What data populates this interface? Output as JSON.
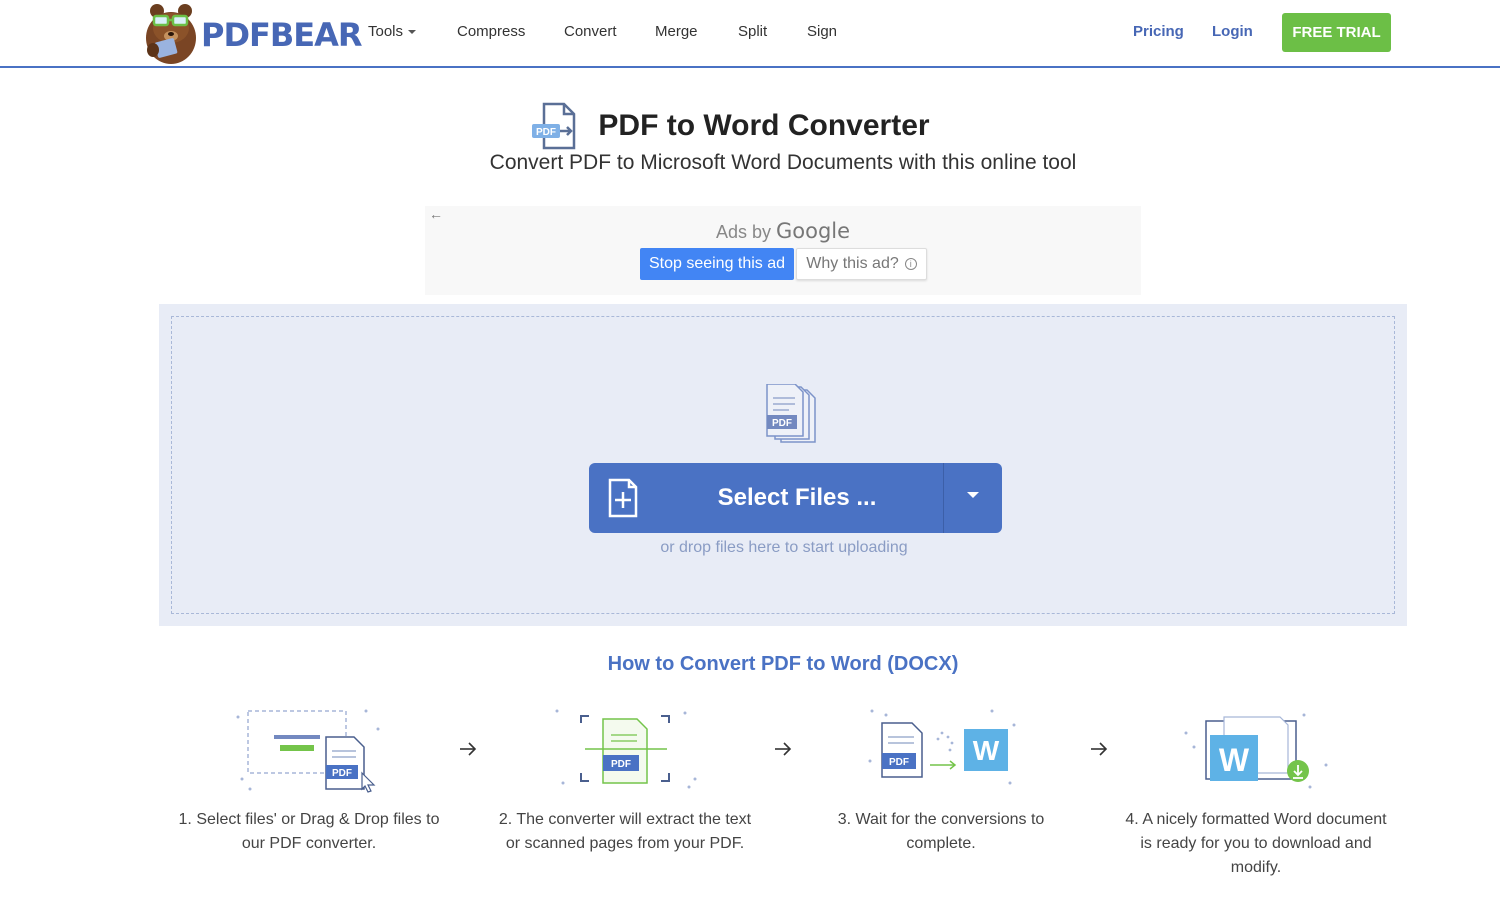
{
  "nav": {
    "brand": "PDFBEAR",
    "tools_label": "Tools",
    "links": [
      "Compress",
      "Convert",
      "Merge",
      "Split",
      "Sign"
    ],
    "pricing_label": "Pricing",
    "login_label": "Login",
    "trial_label": "FREE TRIAL"
  },
  "header": {
    "icon_text": "PDF",
    "title": "PDF to Word Converter",
    "subtitle": "Convert PDF to Microsoft Word Documents with this online tool"
  },
  "ad": {
    "back_glyph": "←",
    "ads_by": "Ads by",
    "brand": "Google",
    "stop_label": "Stop seeing this ad",
    "why_label": "Why this ad?",
    "info_glyph": "i"
  },
  "upload": {
    "icon_text": "PDF",
    "select_label": "Select Files ...",
    "drop_hint": "or drop files here to start uploading"
  },
  "how_to": {
    "title": "How to Convert PDF to Word (DOCX)",
    "steps": [
      {
        "text": "1. Select files' or Drag & Drop files to our PDF converter.",
        "icon_text": "PDF"
      },
      {
        "text": "2. The converter will extract the text or scanned pages from your PDF.",
        "icon_text": "PDF"
      },
      {
        "text": "3. Wait for the conversions to complete.",
        "icon_text": "PDF",
        "icon_text_2": "W"
      },
      {
        "text": "4. A nicely formatted Word document is ready for you to download and modify.",
        "icon_text": "W"
      }
    ]
  },
  "colors": {
    "brand_blue": "#4a72c4",
    "trial_green": "#6cbf46",
    "google_blue": "#4285f4",
    "upload_bg": "#e8ecf6"
  }
}
